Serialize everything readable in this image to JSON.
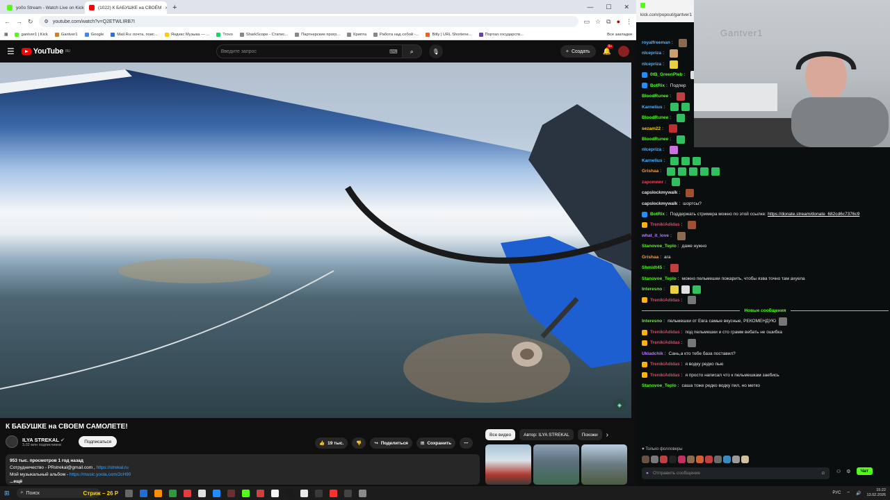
{
  "browser": {
    "tabs": [
      {
        "label": "yo0o Stream - Watch Live on Kick",
        "active": false,
        "color": "#53fc18"
      },
      {
        "label": "(1022) К БАБУШКЕ на СВОЁМ",
        "active": true,
        "color": "#ff0000"
      }
    ],
    "url": "youtube.com/watch?v=Q2ETWLIRB7I",
    "bookmarks": [
      {
        "label": "gantver1 | Kick",
        "color": "#53fc18"
      },
      {
        "label": "Gantver1",
        "color": "#d08020"
      },
      {
        "label": "Google",
        "color": "#4285f4"
      },
      {
        "label": "Mail.Ru: почта, поис...",
        "color": "#2f6de1"
      },
      {
        "label": "Яндекс Музыка — ...",
        "color": "#ffcc00"
      },
      {
        "label": "Trovo",
        "color": "#19d66b"
      },
      {
        "label": "SharkScope - Статис...",
        "color": "#888"
      },
      {
        "label": "Партнерские прогр...",
        "color": "#888"
      },
      {
        "label": "Крипта",
        "color": "#888"
      },
      {
        "label": "Работа над собой -...",
        "color": "#888"
      },
      {
        "label": "Bitly | URL Shortene...",
        "color": "#ee6123"
      },
      {
        "label": "Портал государств...",
        "color": "#6a3fb5"
      }
    ],
    "all_bookmarks": "Все закладки"
  },
  "youtube": {
    "logo": "YouTube",
    "region": "RU",
    "search_placeholder": "Введите запрос",
    "create_label": "Создать",
    "notif_badge": "9+",
    "video_title": "К БАБУШКЕ на СВОЕМ САМОЛЕТЕ!",
    "channel_name": "ILYA STREKAL",
    "subscribers": "3,02 млн подписчиков",
    "subscribe_label": "Подписаться",
    "likes": "19 тыс.",
    "share_label": "Поделиться",
    "save_label": "Сохранить",
    "chips": [
      "Все видео",
      "Автор: ILYA STREKAL",
      "Похожи"
    ],
    "description": {
      "stats": "953 тыс. просмотров  1 год назад",
      "line1_prefix": "Сотрудничество - PRstrekal@gmail.com , ",
      "line1_link": "https://strekal.ru",
      "line2_prefix": "Мой музыкальный альбом - ",
      "line2_link": "https://music.yoola.com/2cH90",
      "more": "...ещё"
    }
  },
  "kick": {
    "url_short": "kick.com/popout/gantver1",
    "cam_label": "Gantver1",
    "messages": [
      {
        "user": "royalfreeman",
        "color": "#4fb3ff",
        "text": "",
        "emotes": [
          "#8a6a50"
        ]
      },
      {
        "user": "nIcepriza",
        "color": "#4fb3ff",
        "text": "",
        "emotes": [
          "#c9a070"
        ]
      },
      {
        "user": "nIcepriza",
        "color": "#4fb3ff",
        "text": "",
        "emotes": [
          "#e8d040"
        ]
      },
      {
        "user": "0tB_GreenPleb",
        "color": "#53fc18",
        "text": "",
        "emotes": [
          "#e0e0e0"
        ],
        "badge": "#1f8fff"
      },
      {
        "user": "BotRix",
        "color": "#53fc18",
        "text": "Подпер",
        "badge": "#1f8fff"
      },
      {
        "user": "BloodRunee",
        "color": "#53fc18",
        "text": "",
        "emotes": [
          "#c04040"
        ]
      },
      {
        "user": "Karnelius",
        "color": "#4fb3ff",
        "text": "",
        "emotes": [
          "#30c060",
          "#30c060"
        ]
      },
      {
        "user": "BloodRunee",
        "color": "#53fc18",
        "text": "",
        "emotes": [
          "#30c060"
        ]
      },
      {
        "user": "sezam22",
        "color": "#ffd400",
        "text": "",
        "emotes": [
          "#c03030"
        ]
      },
      {
        "user": "BloodRunee",
        "color": "#53fc18",
        "text": "",
        "emotes": [
          "#30c060"
        ]
      },
      {
        "user": "nIcepriza",
        "color": "#4fb3ff",
        "text": "",
        "emotes": [
          "#d070e0"
        ]
      },
      {
        "user": "Karnelius",
        "color": "#4fb3ff",
        "text": "",
        "emotes": [
          "#30c060",
          "#30c060",
          "#30c060"
        ]
      },
      {
        "user": "Grishaa",
        "color": "#ff9a2e",
        "text": "",
        "emotes": [
          "#30c060",
          "#30c060",
          "#30c060",
          "#30c060",
          "#30c060"
        ]
      },
      {
        "user": "zapomnnr",
        "color": "#ff3b5c",
        "text": "",
        "emotes": [
          "#30c060"
        ]
      },
      {
        "user": "capslockmywalk",
        "color": "#e6e6e6",
        "text": "",
        "emotes": [
          "#a05030"
        ]
      },
      {
        "user": "capslockmywalk",
        "color": "#e6e6e6",
        "text": "шортсы?"
      },
      {
        "user": "BotRix",
        "color": "#53fc18",
        "text": "Поддержать стримера можно по этой ссылке: ",
        "link": "https://donate.stream/donate_682cd6c7376c9",
        "badge": "#1f8fff"
      },
      {
        "user": "TrenikiAdidas",
        "color": "#ff3b5c",
        "text": "",
        "emotes": [
          "#a05030"
        ],
        "badge": "#ffb300"
      },
      {
        "user": "what_it_love",
        "color": "#b77bff",
        "text": "",
        "emotes": [
          "#8a6a50"
        ]
      },
      {
        "user": "Stanovoe_Teplo",
        "color": "#53fc18",
        "text": "даже нужно"
      },
      {
        "user": "Grishaa",
        "color": "#ff9a2e",
        "text": "ага"
      },
      {
        "user": "Shmidt45",
        "color": "#53fc18",
        "text": "",
        "emotes": [
          "#c04040"
        ]
      },
      {
        "user": "Stanovoe_Teplo",
        "color": "#53fc18",
        "text": "можно пельмешки пожарить, чтобы язва точно там ахуела"
      },
      {
        "user": "Interesno",
        "color": "#53fc18",
        "text": "",
        "emotes": [
          "#e8d040",
          "#e0e0e0",
          "#30c060"
        ]
      },
      {
        "user": "TrenikiAdidas",
        "color": "#ff3b5c",
        "text": "",
        "emotes": [
          "#777"
        ],
        "badge": "#ffb300"
      },
      {
        "new_marker": "Новые сообщения"
      },
      {
        "user": "Interesno",
        "color": "#53fc18",
        "text": "пельмешки от Евга самые вкусные, РЕКОМЕНДУЮ",
        "emotes": [
          "#777"
        ]
      },
      {
        "user": "TrenikiAdidas",
        "color": "#ff3b5c",
        "text": "под пельмешки и сто грамм вебать не ошибка",
        "badge": "#ffb300"
      },
      {
        "user": "TrenikiAdidas",
        "color": "#ff3b5c",
        "text": "",
        "emotes": [
          "#777"
        ],
        "badge": "#ffb300"
      },
      {
        "user": "Ukladchik",
        "color": "#b77bff",
        "text": "Сань,а кто тебе база поставил?"
      },
      {
        "user": "TrenikiAdidas",
        "color": "#ff3b5c",
        "text": "я водку редко пью",
        "badge": "#ffb300"
      },
      {
        "user": "TrenikiAdidas",
        "color": "#ff3b5c",
        "text": "я просто написал что к пельмешкам заебись",
        "badge": "#ffb300"
      },
      {
        "user": "Stanovoe_Teplo",
        "color": "#53fc18",
        "text": "саша тоже редко водку пил, но метко"
      }
    ],
    "followers_only": "Только фолловеры",
    "input_placeholder": "Отправить сообщение",
    "chat_button": "Чат"
  },
  "taskbar": {
    "search_label": "Поиск",
    "promo": "Стриж – 26 Р",
    "lang": "РУС",
    "time": "15:22",
    "date": "13.02.2026"
  }
}
